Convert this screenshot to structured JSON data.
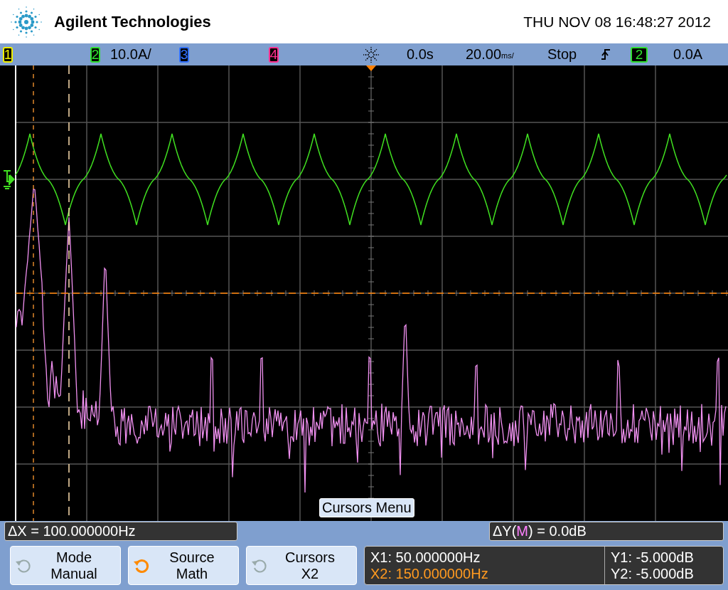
{
  "header": {
    "brand": "Agilent Technologies",
    "datetime": "THU NOV 08 16:48:27 2012"
  },
  "channel_bar": {
    "channels": [
      {
        "label": "1",
        "color": "#f0f000"
      },
      {
        "label": "2",
        "color": "#30e030",
        "scale": "10.0A/"
      },
      {
        "label": "3",
        "color": "#3070ff"
      },
      {
        "label": "4",
        "color": "#ff3090"
      }
    ],
    "delay": "0.0s",
    "timebase": "20.00",
    "timebase_unit": "ms/",
    "run_state": "Stop",
    "trigger": {
      "source": "2",
      "color": "#30e030",
      "level": "0.0A"
    }
  },
  "screen": {
    "menu_label": "Cursors Menu"
  },
  "cursor_bar": {
    "delta_x": "ΔX = 100.000000Hz",
    "delta_y_prefix": "ΔY(",
    "delta_y_source": "M",
    "delta_y_suffix": ") = 0.0dB"
  },
  "softkeys": [
    {
      "title": "Mode",
      "value": "Manual",
      "active": false
    },
    {
      "title": "Source",
      "value": "Math",
      "active": true
    },
    {
      "title": "Cursors",
      "value": "X2",
      "active": false
    }
  ],
  "readout": {
    "x1": "X1: 50.000000Hz",
    "x2": "X2: 150.000000Hz",
    "x2_selected": true,
    "y1": "Y1: -5.000dB",
    "y2": "Y2: -5.000dB"
  }
}
